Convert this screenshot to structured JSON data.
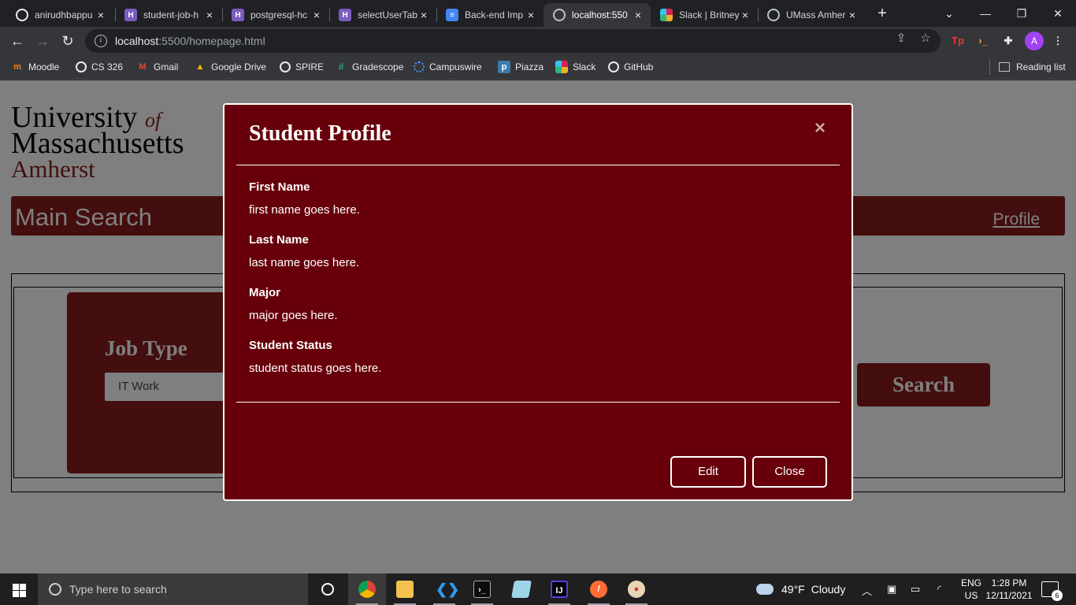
{
  "browser": {
    "tabs": [
      {
        "title": "anirudhbappu",
        "icon": "github-icon"
      },
      {
        "title": "student-job-h",
        "icon": "heroku-icon"
      },
      {
        "title": "postgresql-hc",
        "icon": "heroku-icon"
      },
      {
        "title": "selectUserTab",
        "icon": "heroku-icon"
      },
      {
        "title": "Back-end Imp",
        "icon": "google-docs-icon"
      },
      {
        "title": "localhost:550",
        "icon": "globe-icon"
      },
      {
        "title": "Slack | Britney",
        "icon": "slack-icon"
      },
      {
        "title": "UMass Amher",
        "icon": "globe-icon"
      }
    ],
    "active_tab": 5,
    "address_host": "localhost",
    "address_path": ":5500/homepage.html",
    "profile_initial": "A",
    "bookmarks": [
      {
        "label": "Moodle",
        "icon": "moodle-icon"
      },
      {
        "label": "CS 326",
        "icon": "globe-icon"
      },
      {
        "label": "Gmail",
        "icon": "gmail-icon"
      },
      {
        "label": "Google Drive",
        "icon": "google-drive-icon"
      },
      {
        "label": "SPIRE",
        "icon": "globe-icon"
      },
      {
        "label": "Gradescope",
        "icon": "gradescope-icon"
      },
      {
        "label": "Campuswire",
        "icon": "campuswire-icon"
      },
      {
        "label": "Piazza",
        "icon": "piazza-icon"
      },
      {
        "label": "Slack",
        "icon": "slack-icon"
      },
      {
        "label": "GitHub",
        "icon": "github-icon"
      }
    ],
    "reading_list": "Reading list"
  },
  "page": {
    "logo": {
      "line1": "University",
      "of": "of",
      "line2": "Massachusetts",
      "line3": "Amherst"
    },
    "nav_title": "Main Search",
    "nav_profile": "Profile",
    "job_type_label": "Job Type",
    "job_type_value": "IT Work",
    "search_button": "Search"
  },
  "modal": {
    "title": "Student Profile",
    "close_glyph": "×",
    "fields": [
      {
        "label": "First Name",
        "value": "first name goes here."
      },
      {
        "label": "Last Name",
        "value": "last name goes here."
      },
      {
        "label": "Major",
        "value": "major goes here."
      },
      {
        "label": "Student Status",
        "value": "student status goes here."
      }
    ],
    "edit_button": "Edit",
    "close_button": "Close"
  },
  "taskbar": {
    "search_placeholder": "Type here to search",
    "weather_temp": "49°F",
    "weather_desc": "Cloudy",
    "lang_line1": "ENG",
    "lang_line2": "US",
    "time": "1:28 PM",
    "date": "12/11/2021",
    "notification_count": "6"
  },
  "colors": {
    "umass_maroon": "#881c1c",
    "modal_background": "#67000a",
    "browser_dark": "#202124"
  }
}
